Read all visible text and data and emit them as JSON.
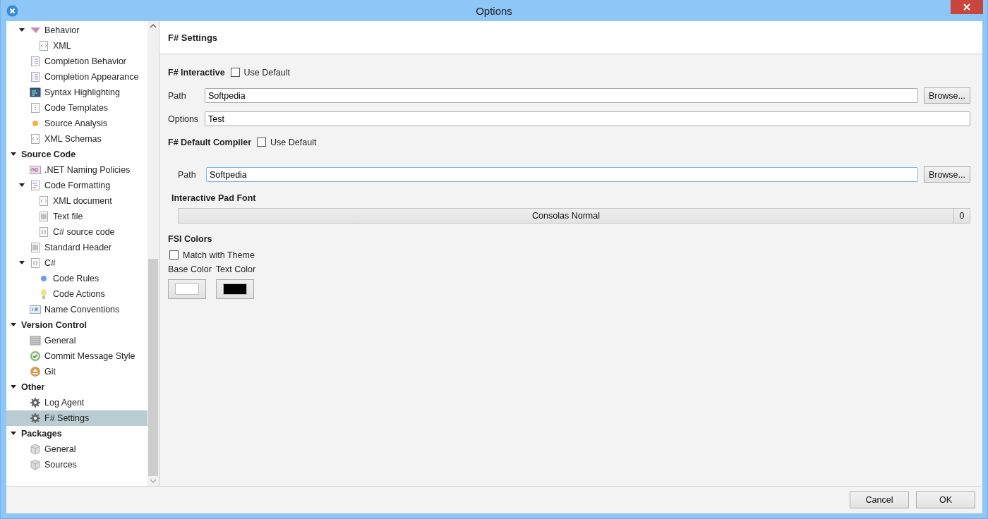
{
  "window": {
    "title": "Options"
  },
  "sidebar": {
    "partial_items": [
      {
        "label": "Behavior",
        "expanded": true,
        "selected": false,
        "children": [
          {
            "label": "XML",
            "selected": false
          }
        ]
      },
      {
        "label": "Completion Behavior",
        "selected": false
      },
      {
        "label": "Completion Appearance",
        "selected": false
      },
      {
        "label": "Syntax Highlighting",
        "selected": false
      },
      {
        "label": "Code Templates",
        "selected": false
      },
      {
        "label": "Source Analysis",
        "selected": false
      },
      {
        "label": "XML Schemas",
        "selected": false
      }
    ],
    "items": [
      {
        "label": "Source Code",
        "expanded": true,
        "selected": false,
        "children": [
          {
            "label": ".NET Naming Policies",
            "selected": false
          },
          {
            "label": "Code Formatting",
            "expanded": true,
            "selected": false,
            "children": [
              {
                "label": "XML document",
                "selected": false
              },
              {
                "label": "Text file",
                "selected": false
              },
              {
                "label": "C# source code",
                "selected": false
              }
            ]
          },
          {
            "label": "Standard Header",
            "selected": false
          },
          {
            "label": "C#",
            "expanded": true,
            "selected": false,
            "children": [
              {
                "label": "Code Rules",
                "selected": false
              },
              {
                "label": "Code Actions",
                "selected": false
              }
            ]
          },
          {
            "label": "Name Conventions",
            "selected": false
          }
        ]
      },
      {
        "label": "Version Control",
        "expanded": true,
        "selected": false,
        "children": [
          {
            "label": "General",
            "selected": false
          },
          {
            "label": "Commit Message Style",
            "selected": false
          },
          {
            "label": "Git",
            "selected": false
          }
        ]
      },
      {
        "label": "Other",
        "expanded": true,
        "selected": false,
        "children": [
          {
            "label": "Log Agent",
            "selected": false
          },
          {
            "label": "F# Settings",
            "selected": true
          }
        ]
      },
      {
        "label": "Packages",
        "expanded": true,
        "selected": false,
        "children": [
          {
            "label": "General",
            "selected": false
          },
          {
            "label": "Sources",
            "selected": false
          }
        ]
      }
    ]
  },
  "page": {
    "title": "F# Settings",
    "interactive": {
      "heading": "F# Interactive",
      "use_default": {
        "label": "Use Default",
        "checked": false
      },
      "path": {
        "label": "Path",
        "value": "Softpedia",
        "button": "Browse..."
      },
      "options": {
        "label": "Options",
        "value": "Test"
      }
    },
    "compiler": {
      "heading": "F# Default Compiler",
      "use_default": {
        "label": "Use Default",
        "checked": false
      },
      "path": {
        "label": "Path",
        "value": "Softpedia",
        "button": "Browse..."
      }
    },
    "pad_font": {
      "heading": "Interactive Pad Font",
      "font": "Consolas Normal",
      "size": "0"
    },
    "fsi_colors": {
      "heading": "FSI Colors",
      "match_theme": {
        "label": "Match with Theme",
        "checked": false
      },
      "swatches": [
        {
          "label": "Base Color",
          "color": "#ffffff"
        },
        {
          "label": "Text Color",
          "color": "#000000"
        }
      ]
    }
  },
  "buttons": [
    "Cancel",
    "OK"
  ]
}
